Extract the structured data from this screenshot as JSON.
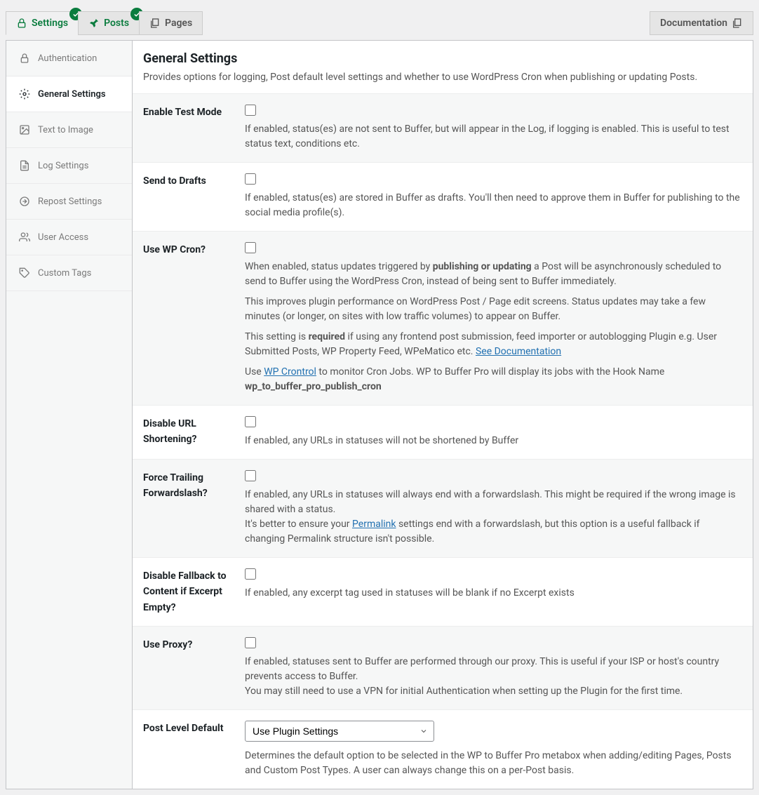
{
  "tabs": {
    "settings": "Settings",
    "posts": "Posts",
    "pages": "Pages",
    "documentation": "Documentation"
  },
  "sidebar": {
    "authentication": "Authentication",
    "general": "General Settings",
    "text_image": "Text to Image",
    "log": "Log Settings",
    "repost": "Repost Settings",
    "user_access": "User Access",
    "custom_tags": "Custom Tags"
  },
  "header": {
    "title": "General Settings",
    "desc": "Provides options for logging, Post default level settings and whether to use WordPress Cron when publishing or updating Posts."
  },
  "rows": {
    "test_mode": {
      "label": "Enable Test Mode",
      "desc": "If enabled, status(es) are not sent to Buffer, but will appear in the Log, if logging is enabled. This is useful to test status text, conditions etc."
    },
    "send_drafts": {
      "label": "Send to Drafts",
      "desc": "If enabled, status(es) are stored in Buffer as drafts. You'll then need to approve them in Buffer for publishing to the social media profile(s)."
    },
    "wp_cron": {
      "label": "Use WP Cron?",
      "d1a": "When enabled, status updates triggered by ",
      "d1b": "publishing or updating",
      "d1c": " a Post will be asynchronously scheduled to send to Buffer using the WordPress Cron, instead of being sent to Buffer immediately.",
      "d2": "This improves plugin performance on WordPress Post / Page edit screens. Status updates may take a few minutes (or longer, on sites with low traffic volumes) to appear on Buffer.",
      "d3a": "This setting is ",
      "d3b": "required",
      "d3c": " if using any frontend post submission, feed importer or autoblogging Plugin e.g. User Submitted Posts, WP Property Feed, WPeMatico etc. ",
      "d3link": "See Documentation",
      "d4a": "Use ",
      "d4link": "WP Crontrol",
      "d4b": " to monitor Cron Jobs. WP to Buffer Pro will display its jobs with the Hook Name ",
      "d4c": "wp_to_buffer_pro_publish_cron"
    },
    "disable_url": {
      "label": "Disable URL Shortening?",
      "desc": "If enabled, any URLs in statuses will not be shortened by Buffer"
    },
    "force_slash": {
      "label": "Force Trailing Forwardslash?",
      "d1": "If enabled, any URLs in statuses will always end with a forwardslash. This might be required if the wrong image is shared with a status.",
      "d2a": "It's better to ensure your ",
      "d2link": "Permalink",
      "d2b": " settings end with a forwardslash, but this option is a useful fallback if changing Permalink structure isn't possible."
    },
    "disable_fallback": {
      "label": "Disable Fallback to Content if Excerpt Empty?",
      "desc": "If enabled, any excerpt tag used in statuses will be blank if no Excerpt exists"
    },
    "use_proxy": {
      "label": "Use Proxy?",
      "d1": "If enabled, statuses sent to Buffer are performed through our proxy. This is useful if your ISP or host's country prevents access to Buffer.",
      "d2": "You may still need to use a VPN for initial Authentication when setting up the Plugin for the first time."
    },
    "post_default": {
      "label": "Post Level Default",
      "selected": "Use Plugin Settings",
      "desc": "Determines the default option to be selected in the WP to Buffer Pro metabox when adding/editing Pages, Posts and Custom Post Types. A user can always change this on a per-Post basis."
    }
  }
}
